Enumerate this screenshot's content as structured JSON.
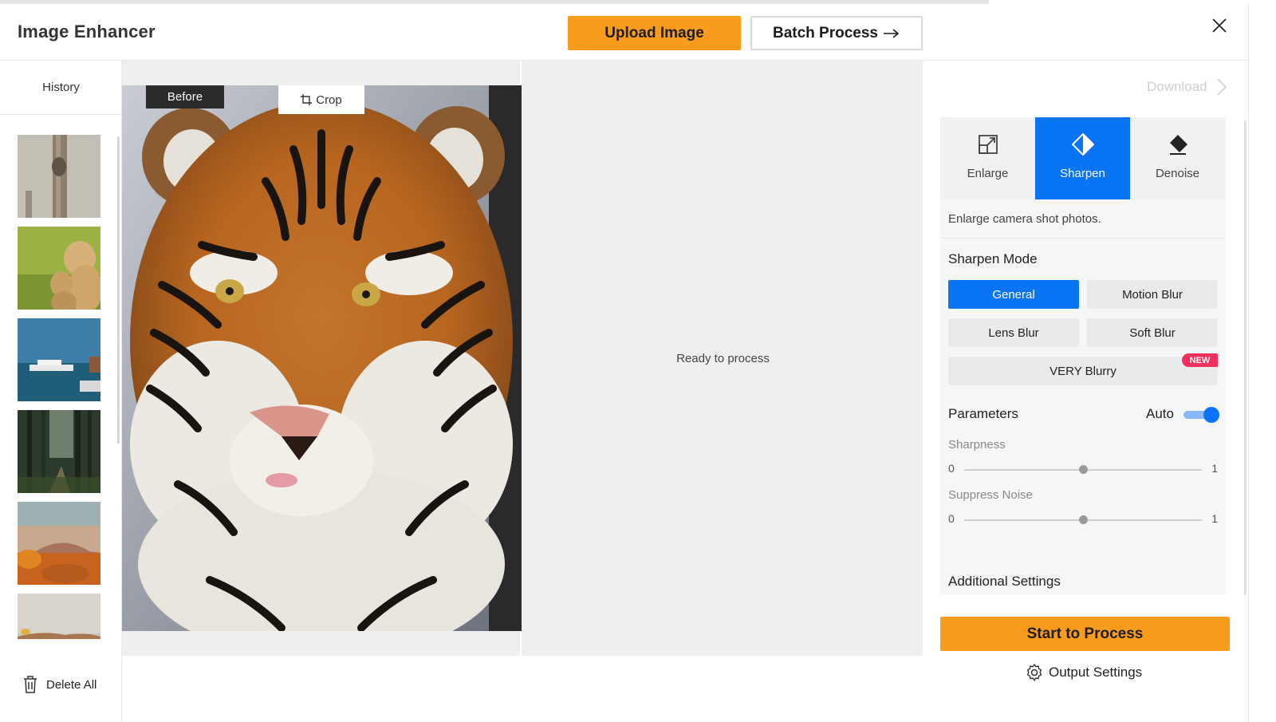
{
  "header": {
    "title": "Image Enhancer",
    "upload_label": "Upload Image",
    "batch_label": "Batch Process"
  },
  "sidebar": {
    "history_label": "History",
    "thumbnails": [
      "tree-trunk",
      "cheetahs",
      "sea-boat",
      "forest",
      "desert-sunset",
      "desert-dusk"
    ],
    "delete_all_label": "Delete All"
  },
  "viewer": {
    "before_label": "Before",
    "crop_label": "Crop",
    "status_text": "Ready to process"
  },
  "panel": {
    "download_label": "Download",
    "modes": [
      {
        "label": "Enlarge",
        "icon": "enlarge-icon",
        "active": false
      },
      {
        "label": "Sharpen",
        "icon": "sharpen-icon",
        "active": true
      },
      {
        "label": "Denoise",
        "icon": "eraser-icon",
        "active": false
      }
    ],
    "description": "Enlarge camera shot photos.",
    "sharpen_mode_title": "Sharpen Mode",
    "options": {
      "general": "General",
      "motion_blur": "Motion Blur",
      "lens_blur": "Lens Blur",
      "soft_blur": "Soft Blur",
      "very_blurry": "VERY Blurry",
      "new_badge": "NEW"
    },
    "selected_option": "General",
    "parameters_title": "Parameters",
    "auto_label": "Auto",
    "auto_enabled": true,
    "sharpness": {
      "label": "Sharpness",
      "min": "0",
      "max": "1",
      "value": 0.5
    },
    "suppress_noise": {
      "label": "Suppress Noise",
      "min": "0",
      "max": "1",
      "value": 0.5
    },
    "additional_title": "Additional Settings",
    "start_label": "Start to Process",
    "output_settings_label": "Output Settings"
  },
  "colors": {
    "accent_orange": "#f99b1c",
    "accent_blue": "#0a74f7",
    "new_badge": "#f0305a"
  }
}
